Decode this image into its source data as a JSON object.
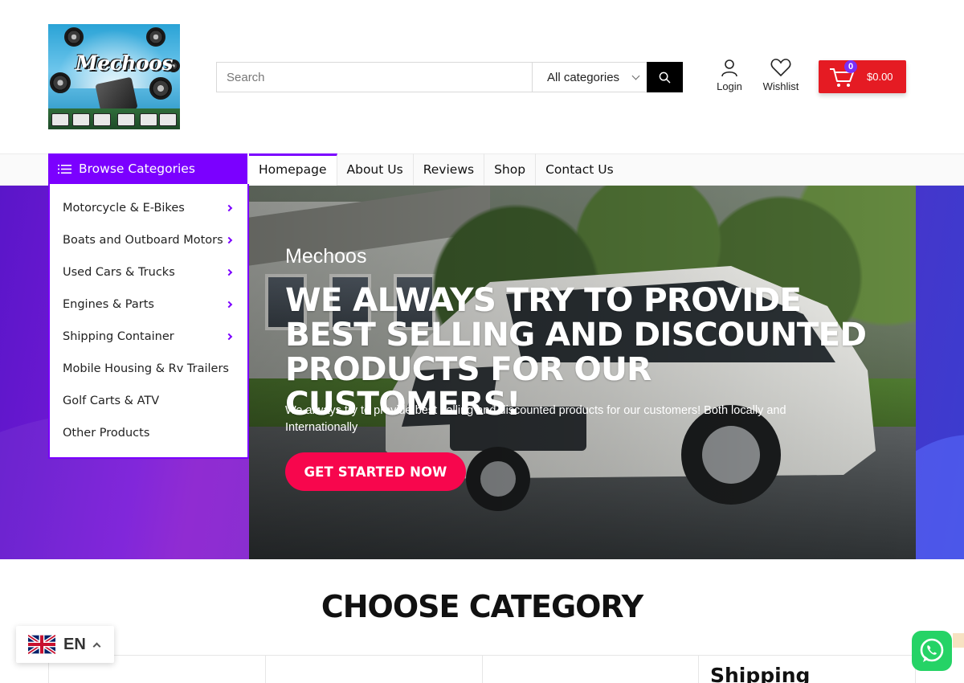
{
  "header": {
    "logo_text": "Mechoos",
    "search": {
      "placeholder": "Search",
      "category": "All categories"
    },
    "login_label": "Login",
    "wishlist_label": "Wishlist",
    "cart": {
      "count": "0",
      "total": "$0.00"
    },
    "accent_color": "#7b00ff",
    "cart_color": "#e51b23"
  },
  "nav": {
    "browse_label": "Browse Categories",
    "links": [
      "Homepage",
      "About Us",
      "Reviews",
      "Shop",
      "Contact Us"
    ],
    "active": "Homepage"
  },
  "categories": [
    {
      "label": "Motorcycle & E-Bikes",
      "has_sub": true
    },
    {
      "label": "Boats and Outboard Motors",
      "has_sub": true
    },
    {
      "label": "Used Cars & Trucks",
      "has_sub": true
    },
    {
      "label": "Engines & Parts",
      "has_sub": true
    },
    {
      "label": "Shipping Container",
      "has_sub": true
    },
    {
      "label": "Mobile Housing & Rv Trailers",
      "has_sub": false
    },
    {
      "label": "Golf Carts & ATV",
      "has_sub": false
    },
    {
      "label": "Other Products",
      "has_sub": false
    }
  ],
  "hero": {
    "subtitle": "Mechoos",
    "title": "WE ALWAYS TRY TO PROVIDE BEST SELLING AND DISCOUNTED PRODUCTS FOR OUR CUSTOMERS!",
    "description": "We always try to provide best selling and discounted products for our customers! Both locally and Internationally",
    "cta": "GET STARTED NOW",
    "cta_color": "#f7064d"
  },
  "section": {
    "title": "CHOOSE CATEGORY",
    "visible_card_title": "Shipping"
  },
  "language": {
    "code": "EN",
    "flag": "uk-flag-icon"
  },
  "whatsapp": {
    "icon": "whatsapp-icon"
  }
}
